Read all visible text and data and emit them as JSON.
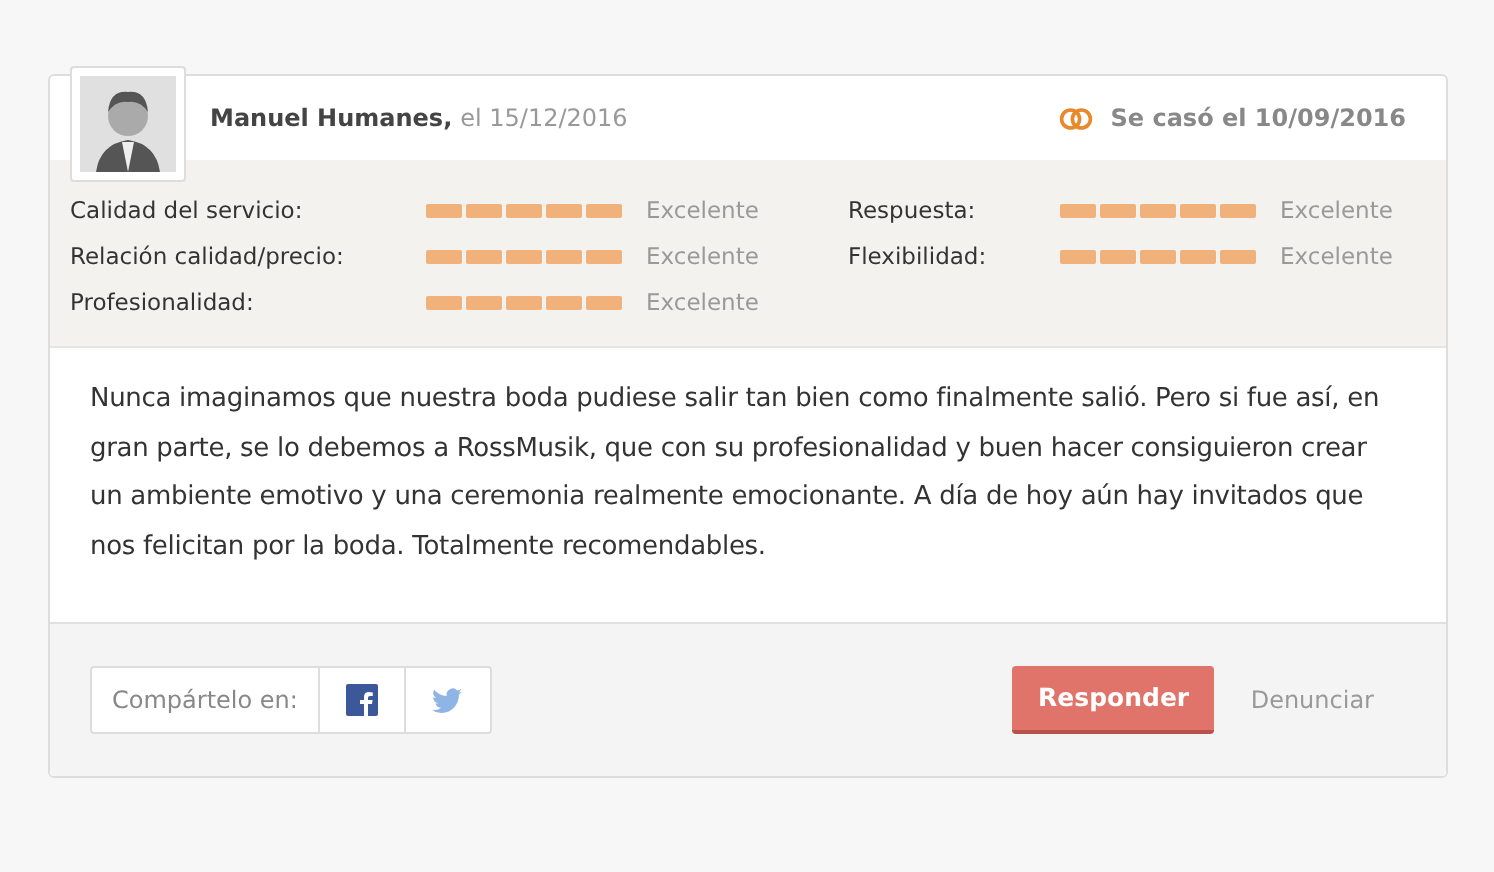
{
  "review": {
    "author": "Manuel Humanes,",
    "date": "el 15/12/2016",
    "wedding": "Se casó el 10/09/2016"
  },
  "ratings": [
    {
      "label": "Calidad del servicio:",
      "stars": 5,
      "reading": "Excelente"
    },
    {
      "label": "Respuesta:",
      "stars": 5,
      "reading": "Excelente"
    },
    {
      "label": "Relación calidad/precio:",
      "stars": 5,
      "reading": "Excelente"
    },
    {
      "label": "Flexibilidad:",
      "stars": 5,
      "reading": "Excelente"
    },
    {
      "label": "Profesionalidad:",
      "stars": 5,
      "reading": "Excelente"
    }
  ],
  "body": "Nunca imaginamos que nuestra boda pudiese salir tan bien como finalmente salió. Pero si fue así, en gran parte, se lo debemos a RossMusik, que con su profesionalidad y buen hacer consiguieron crear un ambiente emotivo y una ceremonia realmente emocionante. A día de hoy aún hay invitados que nos felicitan por la boda. Totalmente recomendables.",
  "footer": {
    "share_label": "Compártelo en:",
    "reply": "Responder",
    "report": "Denunciar"
  }
}
